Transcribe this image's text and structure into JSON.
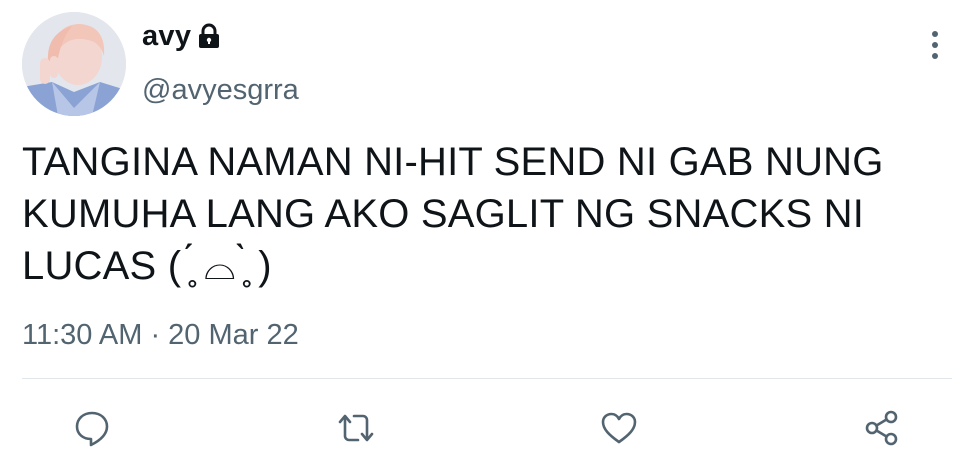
{
  "user": {
    "display_name": "avy",
    "handle": "@avyesgrra",
    "protected_icon": "lock-icon"
  },
  "tweet": {
    "text": "TANGINA NAMAN NI-HIT SEND NI GAB NUNG\nKUMUHA LANG AKO SAGLIT NG SNACKS NI\nLUCAS ( ̥́ ⌓ ̥̀ )",
    "time": "11:30 AM",
    "separator": " · ",
    "date": "20 Mar 22"
  },
  "actions": [
    {
      "icon": "reply-icon"
    },
    {
      "icon": "retweet-icon"
    },
    {
      "icon": "like-icon"
    },
    {
      "icon": "share-icon"
    }
  ],
  "colors": {
    "text": "#0f1419",
    "secondary": "#536471",
    "divider": "#e1e6ea"
  }
}
